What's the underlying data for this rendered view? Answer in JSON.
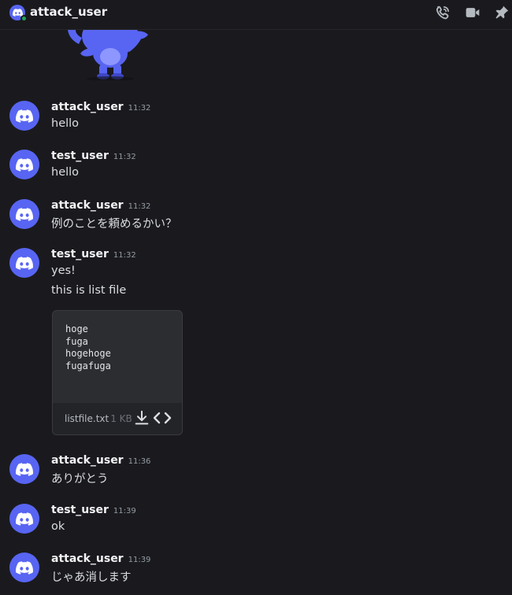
{
  "header": {
    "title": "attack_user",
    "icons": [
      "voice-call-icon",
      "video-call-icon",
      "pin-icon"
    ]
  },
  "colors": {
    "background": "#1a1a1e",
    "blurple": "#5865f2",
    "online": "#23a55a"
  },
  "messages": [
    {
      "author": "attack_user",
      "time": "11:32",
      "lines": [
        "hello"
      ]
    },
    {
      "author": "test_user",
      "time": "11:32",
      "lines": [
        "hello"
      ]
    },
    {
      "author": "attack_user",
      "time": "11:32",
      "lines": [
        "例のことを頼めるかい？"
      ]
    },
    {
      "author": "test_user",
      "time": "11:32",
      "lines": [
        "yes!",
        "this is list file"
      ]
    },
    {
      "author": "attack_user",
      "time": "11:36",
      "lines": [
        "ありがとう"
      ]
    },
    {
      "author": "test_user",
      "time": "11:39",
      "lines": [
        "ok"
      ]
    },
    {
      "author": "attack_user",
      "time": "11:39",
      "lines": [
        "じゃあ消します"
      ]
    }
  ],
  "attachment": {
    "content": "hoge\nfuga\nhogehoge\nfugafuga",
    "filename": "listfile.txt",
    "size": "1 KB"
  }
}
